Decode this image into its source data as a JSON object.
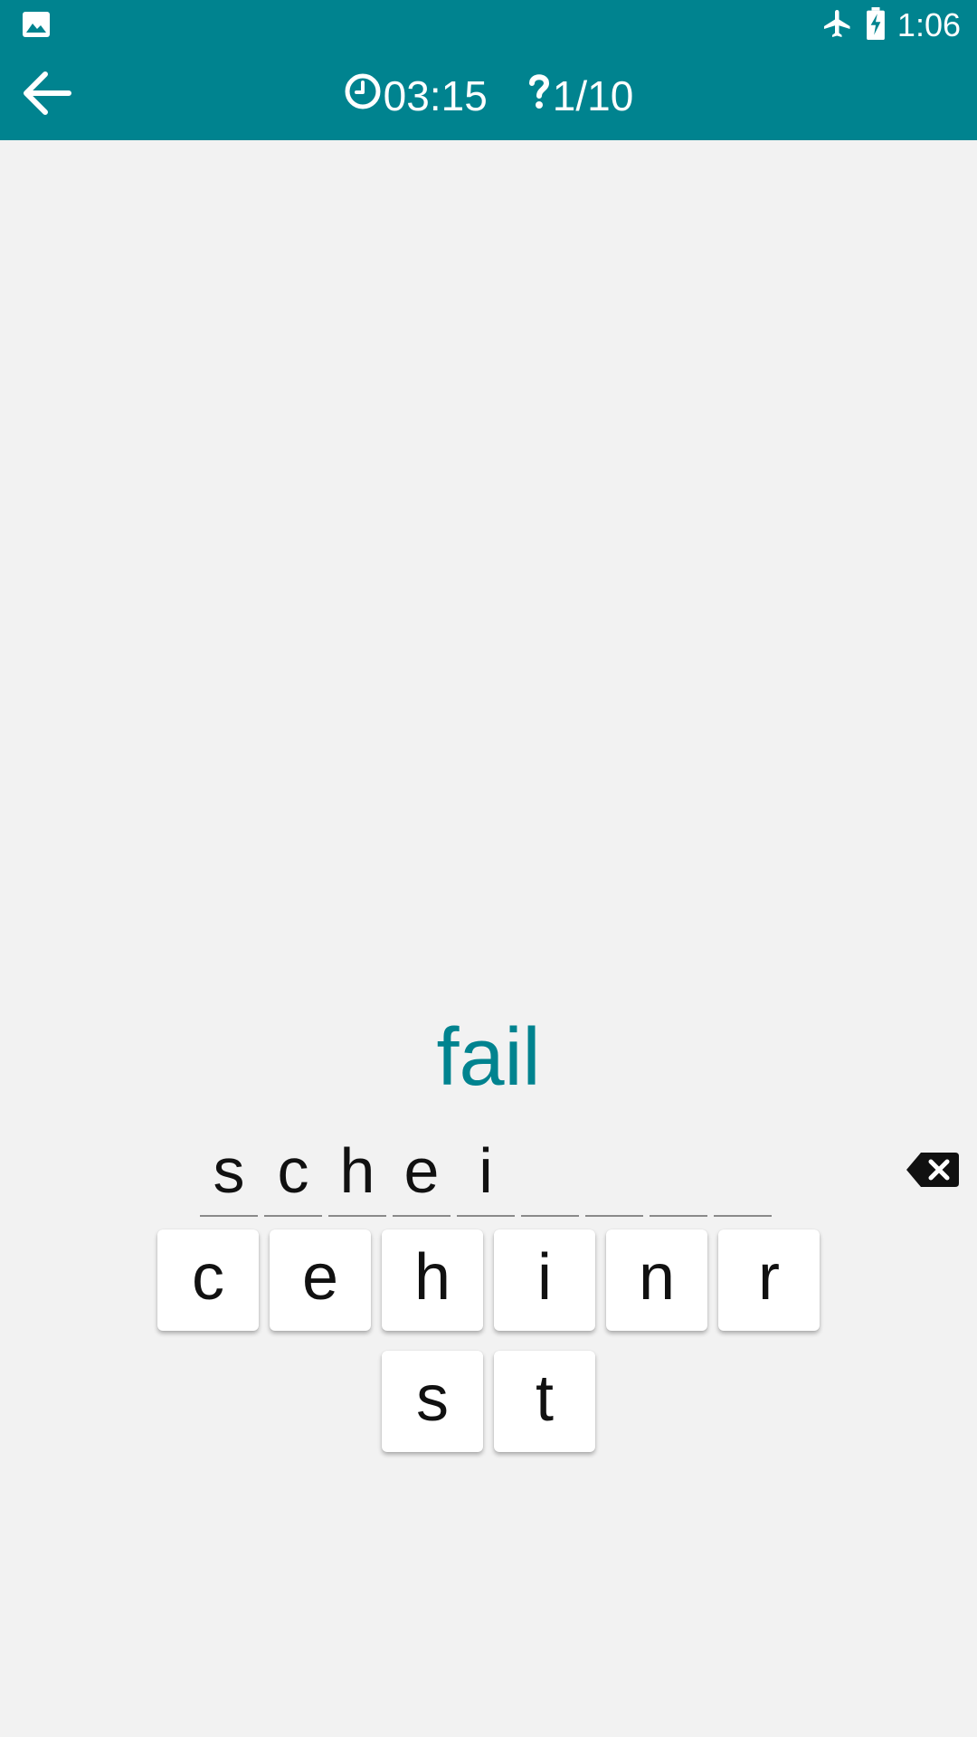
{
  "status_bar": {
    "time": "1:06",
    "icons": [
      "image-notification-icon",
      "airplane-mode-icon",
      "battery-charging-icon"
    ]
  },
  "header": {
    "timer": "03:15",
    "question_counter": "1/10",
    "icons": [
      "back-arrow-icon",
      "clock-icon",
      "question-mark-icon"
    ]
  },
  "quiz": {
    "prompt_word": "fail",
    "answer_slots": [
      "s",
      "c",
      "h",
      "e",
      "i",
      "",
      "",
      "",
      ""
    ]
  },
  "keyboard": {
    "row1": [
      "c",
      "e",
      "h",
      "i",
      "n",
      "r"
    ],
    "row2": [
      "s",
      "t"
    ]
  },
  "colors": {
    "primary": "#00838f",
    "background": "#f2f2f2",
    "key_background": "#ffffff"
  }
}
